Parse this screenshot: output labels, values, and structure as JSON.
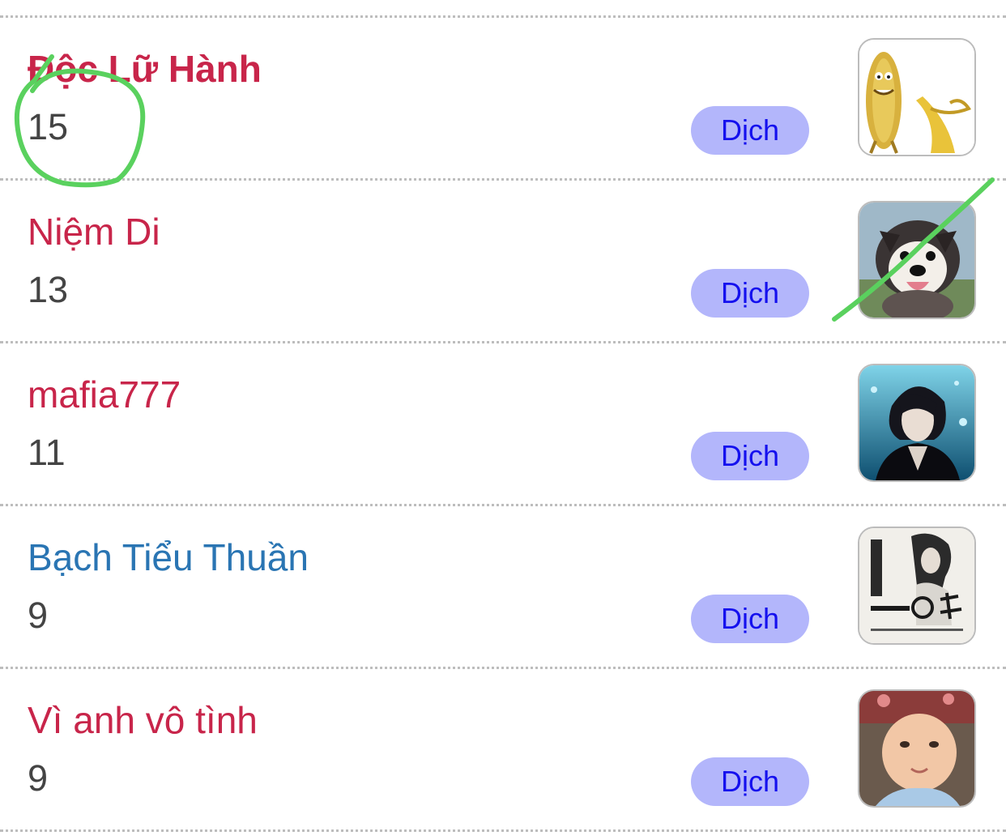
{
  "rows": [
    {
      "name": "Độc Lữ Hành",
      "count": "15",
      "action_label": "Dịch",
      "name_color": "#c8254a",
      "name_bold": true,
      "avatar_icon": "banana-character-avatar"
    },
    {
      "name": "Niệm Di",
      "count": "13",
      "action_label": "Dịch",
      "name_color": "#c8254a",
      "name_bold": false,
      "avatar_icon": "puppy-avatar"
    },
    {
      "name": "mafia777",
      "count": "11",
      "action_label": "Dịch",
      "name_color": "#c8254a",
      "name_bold": false,
      "avatar_icon": "anime-man-avatar"
    },
    {
      "name": "Bạch Tiểu Thuần",
      "count": "9",
      "action_label": "Dịch",
      "name_color": "#2a75b3",
      "name_bold": false,
      "avatar_icon": "ink-art-avatar"
    },
    {
      "name": "Vì anh vô tình",
      "count": "9",
      "action_label": "Dịch",
      "name_color": "#c8254a",
      "name_bold": false,
      "avatar_icon": "baby-photo-avatar"
    }
  ],
  "colors": {
    "button_bg": "#b3b6fb",
    "button_text": "#1410ee",
    "annotation": "#5ad15e"
  }
}
